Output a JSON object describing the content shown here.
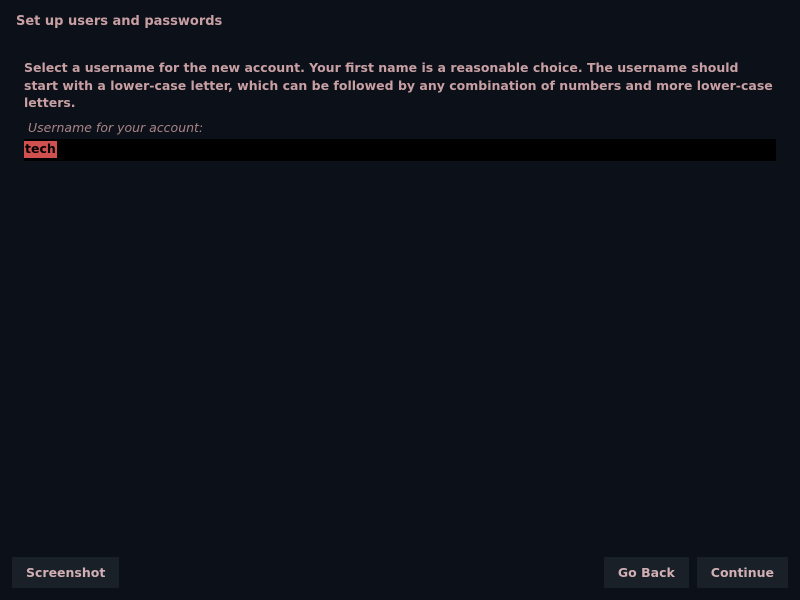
{
  "header": {
    "title": "Set up users and passwords"
  },
  "main": {
    "description": "Select a username for the new account. Your first name is a reasonable choice. The username should start with a lower-case letter, which can be followed by any combination of numbers and more lower-case letters.",
    "field_label": "Username for your account:",
    "username_value": "tech"
  },
  "footer": {
    "screenshot_label": "Screenshot",
    "go_back_label": "Go Back",
    "continue_label": "Continue"
  }
}
